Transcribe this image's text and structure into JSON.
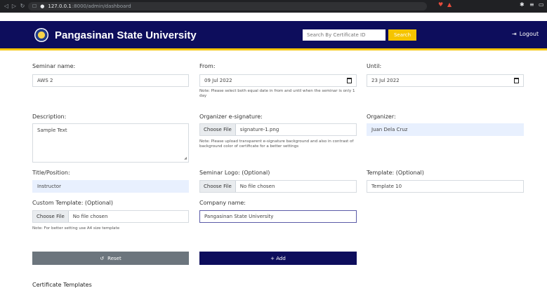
{
  "browser": {
    "url_host": "127.0.0.1",
    "url_path": ":8000/admin/dashboard"
  },
  "header": {
    "brand": "Pangasinan State University",
    "search_placeholder": "Search By Certificate ID",
    "search_button": "Search",
    "logout": "Logout"
  },
  "form": {
    "seminar_name": {
      "label": "Seminar name:",
      "value": "AWS 2"
    },
    "from": {
      "label": "From:",
      "value": "09 Jul 2022",
      "note": "Note: Please select both equal date in from and until when the seminar is only 1 day"
    },
    "until": {
      "label": "Until:",
      "value": "23 Jul 2022"
    },
    "description": {
      "label": "Description:",
      "value": "Sample Text"
    },
    "organizer_signature": {
      "label": "Organizer e-signature:",
      "button": "Choose File",
      "file": "signature-1.png",
      "note": "Note: Please upload transparent e-signature background and also in contrast of background color of certificate for a better settings"
    },
    "organizer": {
      "label": "Organizer:",
      "value": "Juan Dela Cruz"
    },
    "title_position": {
      "label": "Title/Position:",
      "value": "Instructor"
    },
    "seminar_logo": {
      "label": "Seminar Logo: (Optional)",
      "button": "Choose File",
      "file": "No file chosen"
    },
    "template": {
      "label": "Template: (Optional)",
      "value": "Template 10"
    },
    "custom_template": {
      "label": "Custom Template: (Optional)",
      "button": "Choose File",
      "file": "No file chosen",
      "note": "Note: For better setting use A4 size template"
    },
    "company_name": {
      "label": "Company name:",
      "value": "Pangasinan State University"
    }
  },
  "actions": {
    "reset": "Reset",
    "add": "+ Add"
  },
  "section_title": "Certificate Templates",
  "colors": {
    "navy": "#0d0d5c",
    "accent_yellow": "#f5c400",
    "reset_gray": "#6c757d",
    "autofill_blue": "#e8f0fe"
  }
}
